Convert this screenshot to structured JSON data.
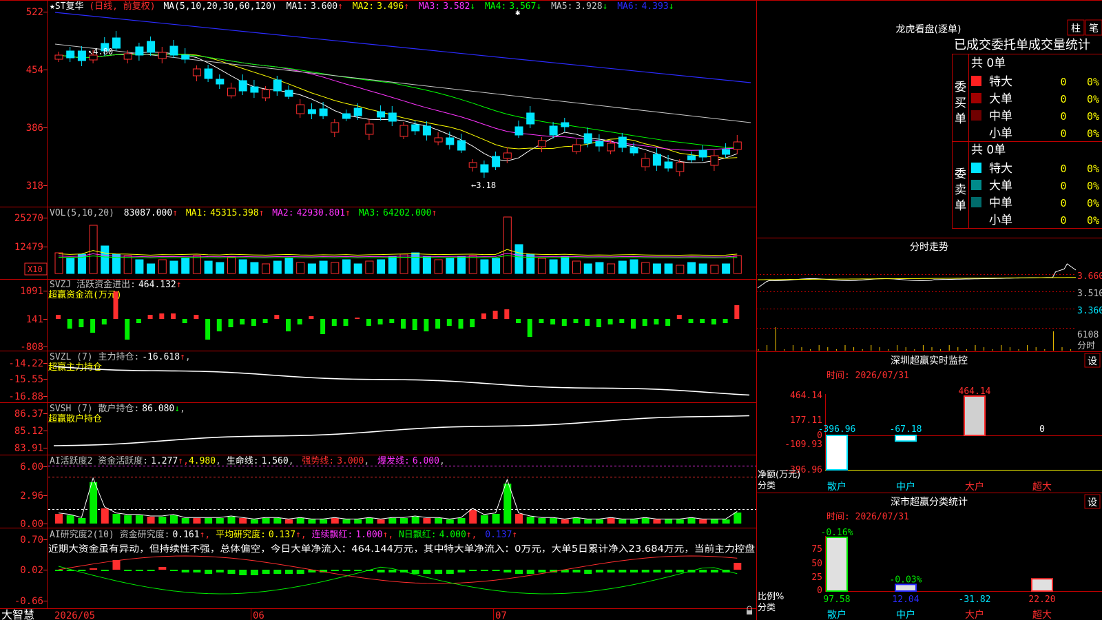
{
  "app": {
    "name": "大智慧"
  },
  "colors": {
    "up": "#ff2e2e",
    "down": "#00e5ff",
    "ma1": "#ffffff",
    "ma2": "#ffff00",
    "ma3": "#ff33ff",
    "ma4": "#00ff00",
    "ma5": "#c8c8c8",
    "ma6": "#2b2bff",
    "border": "#c00000",
    "yellow": "#ffff00"
  },
  "main": {
    "stock": "★ST复华",
    "mode": "(日线, 前复权)",
    "ma_label": "MA(5,10,20,30,60,120)",
    "ma": [
      {
        "label": "MA1:",
        "value": "3.600",
        "dir": "↑"
      },
      {
        "label": "MA2:",
        "value": "3.496",
        "dir": "↑"
      },
      {
        "label": "MA3:",
        "value": "3.582",
        "dir": "↓"
      },
      {
        "label": "MA4:",
        "value": "3.567",
        "dir": "↓"
      },
      {
        "label": "MA5:",
        "value": "3.928",
        "dir": "↓"
      },
      {
        "label": "MA6:",
        "value": "4.393",
        "dir": "↓"
      }
    ],
    "yticks": [
      "522",
      "454",
      "386",
      "318"
    ],
    "high_label": "4.80",
    "low_label": "3.18"
  },
  "vol": {
    "title": "VOL(5,10,20)",
    "value": "83087.000",
    "dir": "↑",
    "ma": [
      {
        "label": "MA1:",
        "value": "45315.398",
        "dir": "↑"
      },
      {
        "label": "MA2:",
        "value": "42930.801",
        "dir": "↑"
      },
      {
        "label": "MA3:",
        "value": "64202.000",
        "dir": "↑"
      }
    ],
    "yticks": [
      "25270",
      "12479"
    ],
    "unit": "X10"
  },
  "svzj": {
    "title": "SVZJ  活跃资金进出:",
    "value": "464.132",
    "dir": "↑",
    "sub": "超赢资金流(万元)",
    "yticks": [
      "1091",
      "141",
      "-808"
    ]
  },
  "svzl": {
    "title": "SVZL (7) 主力持仓:",
    "value": "-16.618",
    "dir": "↑",
    "sub": "超赢主力持仓",
    "yticks": [
      "-14.22",
      "-15.55",
      "-16.88"
    ]
  },
  "svsh": {
    "title": "SVSH (7) 散户持仓:",
    "value": "86.080",
    "dir": "↓",
    "sub": "超赢散户持仓",
    "yticks": [
      "86.37",
      "85.12",
      "83.91"
    ]
  },
  "aihy": {
    "title": "AI活跃度2 资金活跃度:",
    "v1": "1.277",
    "v2": "4.980",
    "life_label": "生命线:",
    "life": "1.560",
    "strong_label": "强势线:",
    "strong": "3.000",
    "burst_label": "爆发线:",
    "burst": "6.000",
    "yticks": [
      "6.00",
      "2.96",
      "0.00"
    ]
  },
  "aiyj": {
    "title": "AI研究度2(10) 资金研究度:",
    "v1": "0.161",
    "avg_label": "平均研究度:",
    "avg": "0.137",
    "cont_label": "连续飘红:",
    "cont": "1.000",
    "nday_label": "N日飘红:",
    "nday": "4.000",
    "v5": "0.137",
    "text": "近期大资金虽有异动，但持续性不强，总体偏空，今日大单净流入：464.144万元，其中特大单净流入：0万元，大单5日累计净入23.684万元，当前主力控盘",
    "yticks": [
      "0.70",
      "0.02",
      "-0.66"
    ]
  },
  "xaxis": [
    "2026/05",
    "06",
    "07"
  ],
  "right": {
    "lhb_title": "龙虎看盘(逐单)",
    "btn_zhu": "柱",
    "btn_bi": "笔",
    "tabs": [
      "已成交",
      "委托单",
      "成交量统计"
    ],
    "buy": {
      "label": "委买单",
      "total": "共 0单",
      "rows": [
        {
          "name": "特大",
          "n": "0",
          "p": "0%",
          "color": "#ff2020"
        },
        {
          "name": "大单",
          "n": "0",
          "p": "0%",
          "color": "#a00000"
        },
        {
          "name": "中单",
          "n": "0",
          "p": "0%",
          "color": "#700000"
        },
        {
          "name": "小单",
          "n": "0",
          "p": "0%",
          "color": ""
        }
      ]
    },
    "sell": {
      "label": "委卖单",
      "total": "共 0单",
      "rows": [
        {
          "name": "特大",
          "n": "0",
          "p": "0%",
          "color": "#00e5ff"
        },
        {
          "name": "大单",
          "n": "0",
          "p": "0%",
          "color": "#008b8b"
        },
        {
          "name": "中单",
          "n": "0",
          "p": "0%",
          "color": "#006b6b"
        },
        {
          "name": "小单",
          "n": "0",
          "p": "0%",
          "color": ""
        }
      ]
    },
    "fs_title": "分时走势",
    "fs_ticks": [
      "3.660",
      "3.510",
      "3.360",
      "6108",
      "分时"
    ],
    "mon_title": "深圳超赢实时监控",
    "mon_time": "时间: 2026/07/31",
    "mon_yticks": [
      "464.14",
      "177.11",
      "0",
      "-109.93",
      "-396.96"
    ],
    "mon_bars": [
      {
        "cat": "散户",
        "value": -396.96,
        "label": "-396.96"
      },
      {
        "cat": "中户",
        "value": -67.18,
        "label": "-67.18"
      },
      {
        "cat": "大户",
        "value": 464.14,
        "label": "464.14"
      },
      {
        "cat": "超大",
        "value": 0,
        "label": "0"
      }
    ],
    "mon_side": "净额(万元)",
    "cls_label": "分类",
    "cls_title": "深市超赢分类统计",
    "cls_time": "时间: 2026/07/31",
    "cls_yticks": [
      "75",
      "50",
      "25",
      "0"
    ],
    "cls_top": [
      {
        "label": "-0.16%",
        "value": 97.58
      },
      {
        "label": "-0.03%",
        "value": 12.04
      },
      {
        "label": "",
        "value": 0
      },
      {
        "label": "",
        "value": 22.2
      }
    ],
    "cls_vals": [
      "97.58",
      "12.04",
      "-31.82",
      "22.20"
    ],
    "cls_side": "比例%",
    "set": "设"
  }
}
